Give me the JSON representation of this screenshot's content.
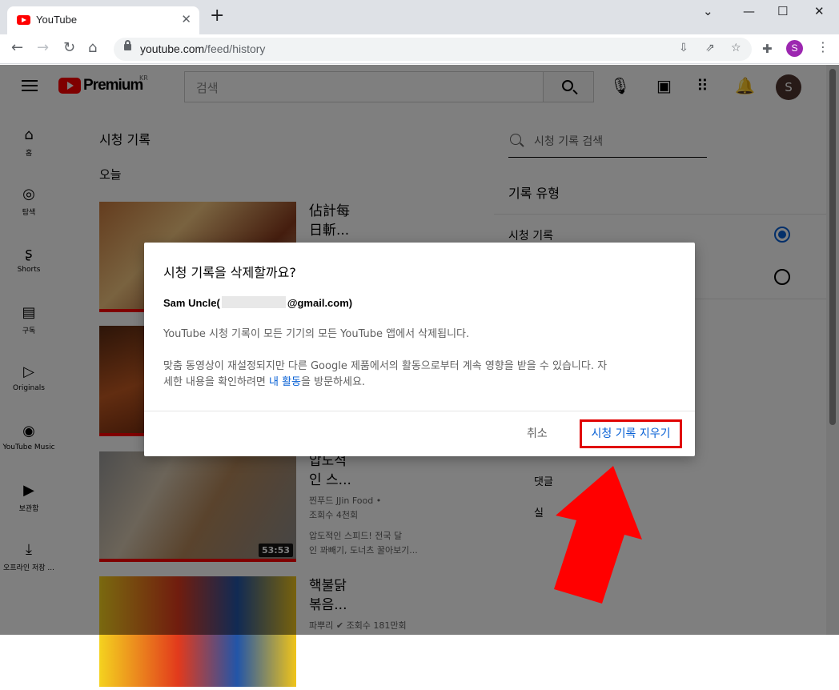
{
  "browser": {
    "tab_title": "YouTube",
    "tab_close": "✕",
    "new_tab": "+",
    "window_controls": [
      "⌄",
      "—",
      "☐",
      "✕"
    ],
    "url_host": "youtube.com",
    "url_path": "/feed/history",
    "profile_initial": "S"
  },
  "yt": {
    "logo_text": "Premium",
    "region": "KR",
    "search_placeholder": "검색",
    "avatar_initial": "S",
    "guide": [
      {
        "icon": "⌂",
        "label": "홈"
      },
      {
        "icon": "◎",
        "label": "탐색"
      },
      {
        "icon": "ʂ",
        "label": "Shorts"
      },
      {
        "icon": "▤",
        "label": "구독"
      },
      {
        "icon": "▷",
        "label": "Originals"
      },
      {
        "icon": "◉",
        "label": "YouTube Music"
      },
      {
        "icon": "▶",
        "label": "보관함"
      },
      {
        "icon": "⤓",
        "label": "오프라인 저장 ..."
      }
    ],
    "page_title": "시청 기록",
    "section_today": "오늘",
    "videos": [
      {
        "title": "佔計每 日斬...",
        "meta1": "",
        "meta2": "",
        "meta3": "",
        "meta4": "",
        "duration": ""
      },
      {
        "title": "",
        "meta1": "",
        "meta2": "",
        "meta3": "",
        "meta4": "",
        "duration": ""
      },
      {
        "title": "압도적 인 스...",
        "meta1": "찐푸드 JJin Food •",
        "meta2": "조회수 4천회",
        "meta3": "압도적인 스피드! 전국 달",
        "meta4": "인 꽈빼기, 도너츠 꿀아보기...",
        "duration": "53:53"
      },
      {
        "title": "핵불닭 볶음...",
        "meta1": "파뿌리 ✔ 조회수 181만회",
        "meta2": "",
        "meta3": "",
        "meta4": "",
        "duration": ""
      }
    ],
    "right_panel": {
      "search_placeholder": "시청 기록 검색",
      "history_type_heading": "기록 유형",
      "option_watch": "시청 기록",
      "link_comments": "댓글",
      "link_more": "실"
    }
  },
  "dialog": {
    "title": "시청 기록을 삭제할까요?",
    "account_name": "Sam Uncle(",
    "account_email": "@gmail.com)",
    "line1": "YouTube 시청 기록이 모든 기기의 모든 YouTube 앱에서 삭제됩니다.",
    "line2a": " 맞춤 동영상이 재설정되지만 다른 Google 제품에서의 활동으로부터 계속 영향을 받을 수 있습니다. 자",
    "line2b_pre": "세한 내용을 확인하려면 ",
    "line2b_link": "내 활동",
    "line2b_post": "을 방문하세요.",
    "cancel": "취소",
    "confirm": "시청 기록 지우기"
  },
  "colors": {
    "youtube_red": "#ff0000",
    "link_blue": "#065fd4",
    "highlight_red": "#e00000",
    "arrow_red": "#ff0000",
    "profile_purple": "#9c27b0"
  }
}
